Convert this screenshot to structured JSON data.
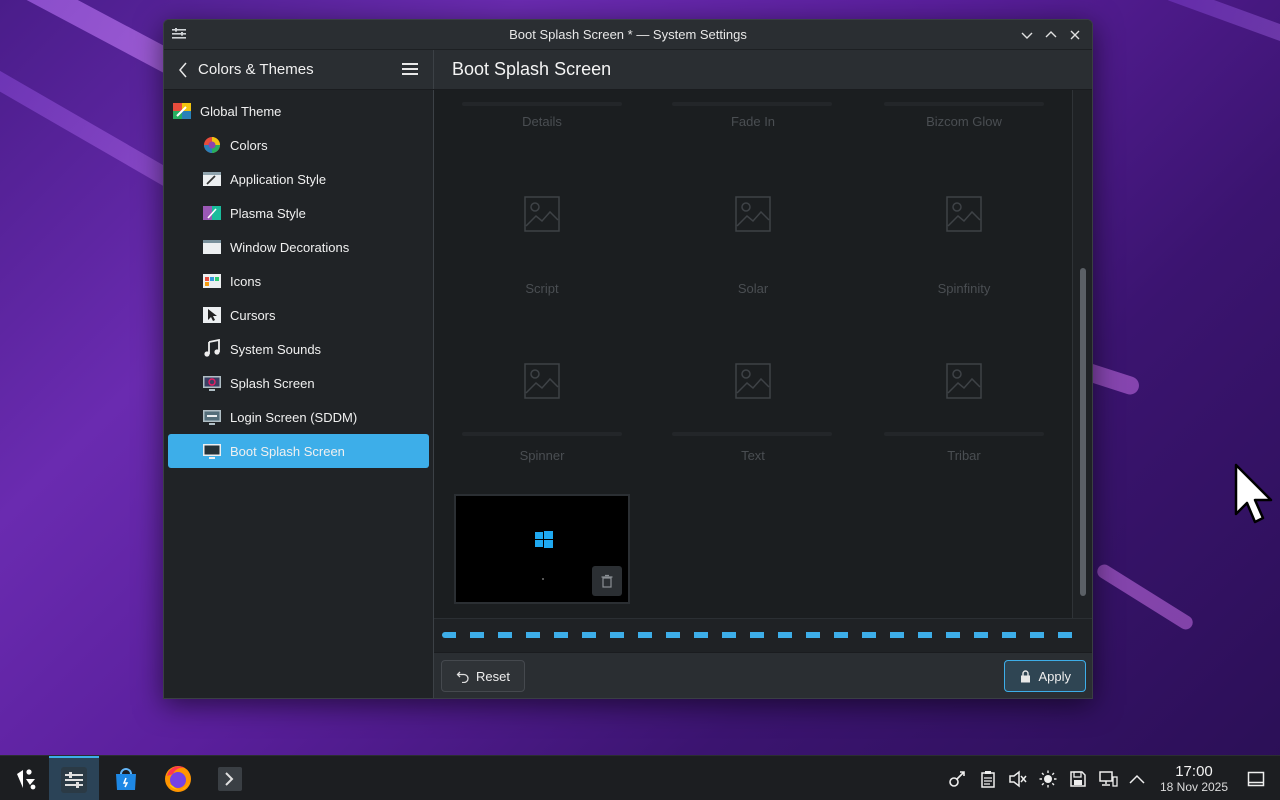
{
  "window": {
    "title": "Boot Splash Screen * — System Settings"
  },
  "header": {
    "breadcrumb": "Colors & Themes",
    "page_title": "Boot Splash Screen"
  },
  "sidebar": {
    "items": [
      {
        "label": "Global Theme",
        "icon": "global-theme-icon",
        "level": "top"
      },
      {
        "label": "Colors",
        "icon": "colors-icon",
        "level": "sub"
      },
      {
        "label": "Application Style",
        "icon": "application-style-icon",
        "level": "sub"
      },
      {
        "label": "Plasma Style",
        "icon": "plasma-style-icon",
        "level": "sub"
      },
      {
        "label": "Window Decorations",
        "icon": "window-decorations-icon",
        "level": "sub"
      },
      {
        "label": "Icons",
        "icon": "icons-icon",
        "level": "sub"
      },
      {
        "label": "Cursors",
        "icon": "cursors-icon",
        "level": "sub"
      },
      {
        "label": "System Sounds",
        "icon": "music-note-icon",
        "level": "sub"
      },
      {
        "label": "Splash Screen",
        "icon": "splash-screen-icon",
        "level": "sub"
      },
      {
        "label": "Login Screen (SDDM)",
        "icon": "login-screen-icon",
        "level": "sub"
      },
      {
        "label": "Boot Splash Screen",
        "icon": "monitor-icon",
        "level": "sub",
        "active": true
      }
    ]
  },
  "themes": {
    "row0": [
      "Details",
      "Fade In",
      "Bizcom Glow"
    ],
    "row1": [
      "Script",
      "Solar",
      "Spinfinity"
    ],
    "row2": [
      "Spinner",
      "Text",
      "Tribar"
    ]
  },
  "footer": {
    "reset_label": "Reset",
    "apply_label": "Apply"
  },
  "taskbar": {
    "time": "17:00",
    "date": "18 Nov 2025"
  },
  "colors": {
    "accent": "#3daee9",
    "window_bg": "#202326",
    "content_bg": "#1b1e20"
  }
}
